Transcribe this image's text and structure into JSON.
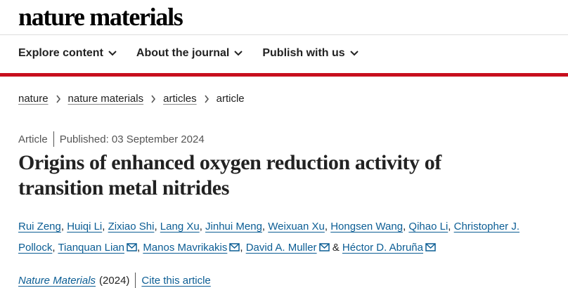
{
  "header": {
    "logo": "nature materials"
  },
  "nav": [
    {
      "label": "Explore content"
    },
    {
      "label": "About the journal"
    },
    {
      "label": "Publish with us"
    }
  ],
  "breadcrumb": [
    {
      "label": "nature"
    },
    {
      "label": "nature materials"
    },
    {
      "label": "articles"
    },
    {
      "label": "article"
    }
  ],
  "article": {
    "type": "Article",
    "published": "Published: 03 September 2024",
    "title": "Origins of enhanced oxygen reduction activity of transition metal nitrides",
    "authors": [
      {
        "name": "Rui Zeng"
      },
      {
        "name": "Huiqi Li"
      },
      {
        "name": "Zixiao Shi"
      },
      {
        "name": "Lang Xu"
      },
      {
        "name": "Jinhui Meng"
      },
      {
        "name": "Weixuan Xu"
      },
      {
        "name": "Hongsen Wang"
      },
      {
        "name": "Qihao Li"
      },
      {
        "name": "Christopher J. Pollock"
      },
      {
        "name": "Tianquan Lian"
      },
      {
        "name": "Manos Mavrikakis"
      },
      {
        "name": "David A. Muller"
      },
      {
        "name": "Héctor D. Abruña"
      }
    ],
    "separators": {
      "comma": ",",
      "ampersand": "&"
    },
    "journal": "Nature Materials",
    "year": "(2024)",
    "cite_label": "Cite this article"
  },
  "colors": {
    "accent_red": "#c80f1e",
    "link_blue": "#0b5d94"
  },
  "icons": {
    "nav_dropdown": "chevron-down-icon",
    "breadcrumb_sep": "chevron-right-icon",
    "author_contact": "envelope-icon"
  }
}
